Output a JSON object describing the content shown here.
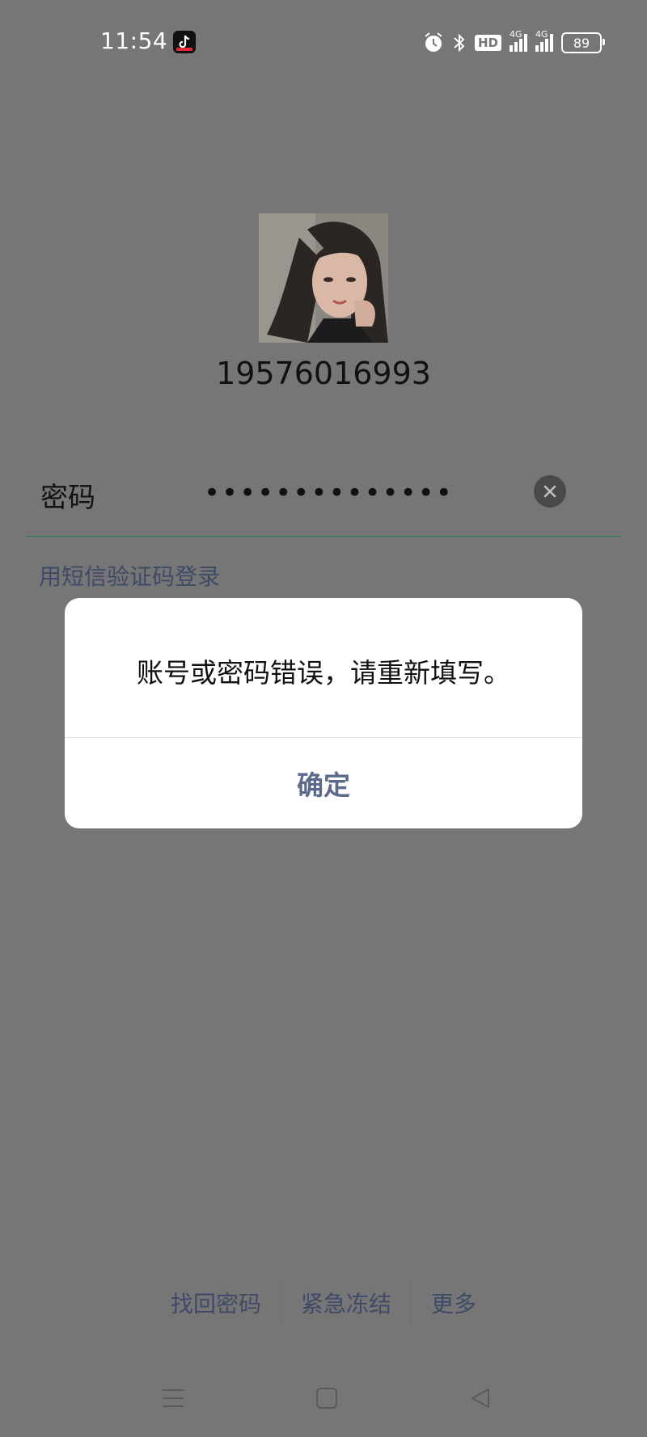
{
  "status_bar": {
    "time": "11:54",
    "icons": [
      "tiktok-icon",
      "alarm-icon",
      "bluetooth-icon",
      "hd-icon",
      "signal-4g-icon",
      "signal-4g-icon"
    ],
    "hd_label": "HD",
    "network_1": "4G",
    "network_2": "4G",
    "battery": "89"
  },
  "profile": {
    "account": "19576016993"
  },
  "password": {
    "label": "密码",
    "value": "••••••••••••••"
  },
  "sms_login_link": "用短信验证码登录",
  "dialog": {
    "message": "账号或密码错误，请重新填写。",
    "confirm": "确定"
  },
  "bottom_links": {
    "recover": "找回密码",
    "freeze": "紧急冻结",
    "more": "更多"
  },
  "colors": {
    "overlay": "#767676",
    "link": "#3e4a66",
    "dialog_button": "#5b6a8a",
    "underline": "#2a7a4f"
  }
}
